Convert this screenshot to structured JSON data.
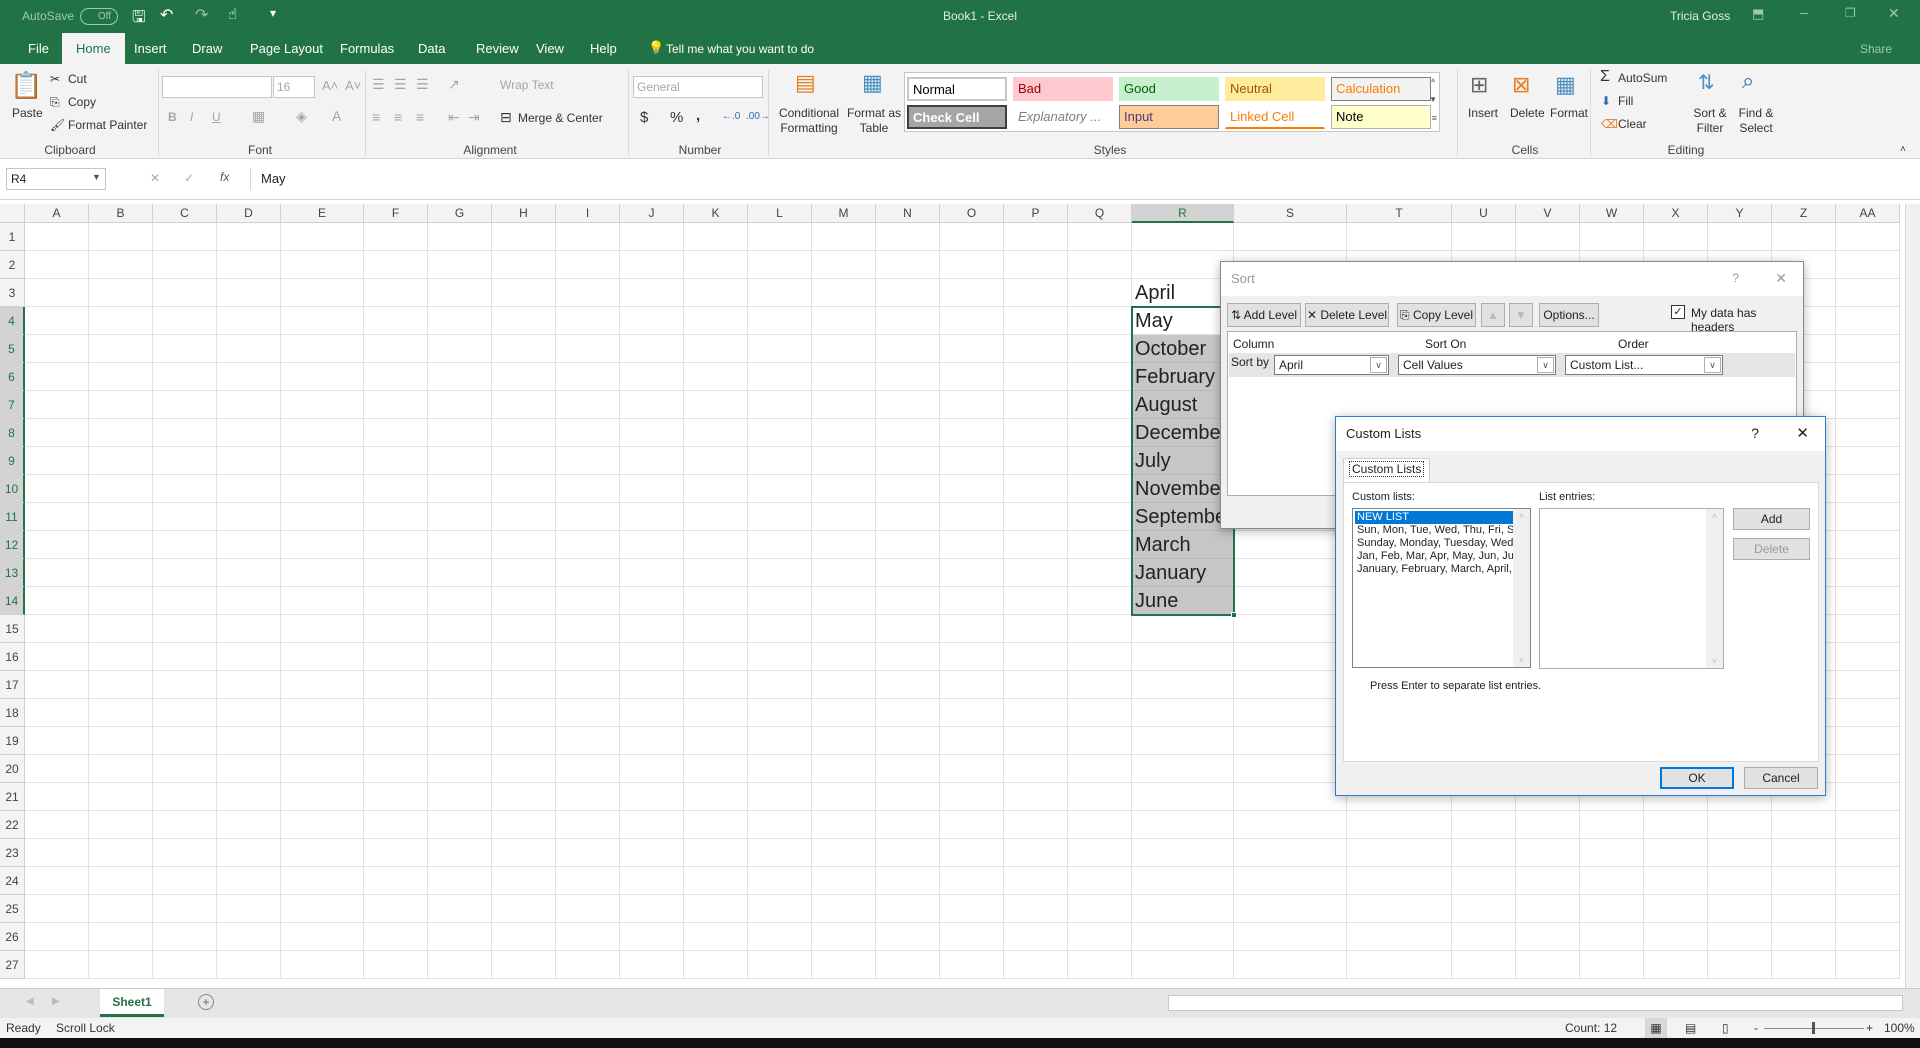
{
  "app": {
    "title": "Book1  -  Excel",
    "user": "Tricia Goss",
    "autosave_label": "AutoSave",
    "autosave_state": "Off",
    "share_label": "Share",
    "accent": "#217346"
  },
  "ribbon_tabs": [
    "File",
    "Home",
    "Insert",
    "Draw",
    "Page Layout",
    "Formulas",
    "Data",
    "Review",
    "View",
    "Help"
  ],
  "active_tab": "Home",
  "tell_me": "Tell me what you want to do",
  "clipboard": {
    "paste": "Paste",
    "cut": "Cut",
    "copy": "Copy",
    "format_painter": "Format Painter",
    "label": "Clipboard"
  },
  "font": {
    "name": "",
    "size": "16",
    "label": "Font",
    "bold": "B",
    "italic": "I",
    "underline": "U"
  },
  "alignment": {
    "wrap_text": "Wrap Text",
    "merge_center": "Merge & Center",
    "label": "Alignment"
  },
  "number": {
    "format": "General",
    "currency": "$",
    "percent": "%",
    "comma": ",",
    "label": "Number"
  },
  "styles": {
    "conditional": "Conditional Formatting",
    "format_table": "Format as Table",
    "label": "Styles",
    "gallery": [
      {
        "name": "Normal",
        "color": "#000000",
        "bg": "#ffffff"
      },
      {
        "name": "Bad",
        "color": "#9c0006",
        "bg": "#ffc7ce"
      },
      {
        "name": "Good",
        "color": "#006100",
        "bg": "#c6efce"
      },
      {
        "name": "Neutral",
        "color": "#9c5700",
        "bg": "#ffeb9c"
      },
      {
        "name": "Calculation",
        "color": "#fa7d00",
        "bg": "#f2f2f2"
      },
      {
        "name": "Check Cell",
        "color": "#ffffff",
        "bg": "#a5a5a5"
      },
      {
        "name": "Explanatory ...",
        "color": "#7f7f7f",
        "bg": "#ffffff"
      },
      {
        "name": "Input",
        "color": "#3f3f76",
        "bg": "#ffcc99"
      },
      {
        "name": "Linked Cell",
        "color": "#fa7d00",
        "bg": "#ffffff"
      },
      {
        "name": "Note",
        "color": "#000000",
        "bg": "#ffffcc"
      }
    ]
  },
  "cells_group": {
    "insert": "Insert",
    "delete": "Delete",
    "format": "Format",
    "label": "Cells"
  },
  "editing": {
    "autosum": "AutoSum",
    "fill": "Fill",
    "clear": "Clear",
    "sort_filter": "Sort & Filter",
    "find_select": "Find & Select",
    "label": "Editing"
  },
  "formula_bar": {
    "name_box": "R4",
    "fx": "fx",
    "value": "May"
  },
  "sheet": {
    "columns": [
      "A",
      "B",
      "C",
      "D",
      "E",
      "F",
      "G",
      "H",
      "I",
      "J",
      "K",
      "L",
      "M",
      "N",
      "O",
      "P",
      "Q",
      "R",
      "S",
      "T",
      "U",
      "V",
      "W",
      "X",
      "Y",
      "Z",
      "AA"
    ],
    "rows": [
      "1",
      "2",
      "3",
      "4",
      "5",
      "6",
      "7",
      "8",
      "9",
      "10",
      "11",
      "12",
      "13",
      "14",
      "15",
      "16",
      "17",
      "18",
      "19",
      "20",
      "21",
      "22",
      "23",
      "24",
      "25",
      "26",
      "27"
    ],
    "selected_column": "R",
    "active_cell": "R4",
    "selection": "R4:R14",
    "cells": [
      {
        "ref": "R3",
        "value": "April"
      },
      {
        "ref": "R4",
        "value": "May"
      },
      {
        "ref": "R5",
        "value": "October"
      },
      {
        "ref": "R6",
        "value": "February"
      },
      {
        "ref": "R7",
        "value": "August"
      },
      {
        "ref": "R8",
        "value": "December"
      },
      {
        "ref": "R9",
        "value": "July"
      },
      {
        "ref": "R10",
        "value": "November"
      },
      {
        "ref": "R11",
        "value": "September"
      },
      {
        "ref": "R12",
        "value": "March"
      },
      {
        "ref": "R13",
        "value": "January"
      },
      {
        "ref": "R14",
        "value": "June"
      }
    ]
  },
  "sort_dialog": {
    "title": "Sort",
    "help": "?",
    "add_level": "Add Level",
    "delete_level": "Delete Level",
    "copy_level": "Copy Level",
    "options": "Options...",
    "headers_label": "My data has headers",
    "headers_checked": true,
    "col_headers": [
      "Column",
      "Sort On",
      "Order"
    ],
    "row_label": "Sort by",
    "column_value": "April",
    "sort_on_value": "Cell Values",
    "order_value": "Custom List..."
  },
  "custom_lists_dialog": {
    "title": "Custom Lists",
    "help": "?",
    "tab": "Custom Lists",
    "lists_label": "Custom lists:",
    "entries_label": "List entries:",
    "lists": [
      "NEW LIST",
      "Sun, Mon, Tue, Wed, Thu, Fri, Sat",
      "Sunday, Monday, Tuesday, Wednesday, Thursday, Friday, Saturday",
      "Jan, Feb, Mar, Apr, May, Jun, Jul, Aug, Sep, Oct, Nov, Dec",
      "January, February, March, April, May, June, July, August, September, October, November, December"
    ],
    "selected_list": "NEW LIST",
    "add": "Add",
    "delete": "Delete",
    "hint": "Press Enter to separate list entries.",
    "ok": "OK",
    "cancel": "Cancel"
  },
  "sheet_tabs": [
    "Sheet1"
  ],
  "status": {
    "ready": "Ready",
    "scroll_lock": "Scroll Lock",
    "count": "Count: 12",
    "zoom": "100%"
  }
}
